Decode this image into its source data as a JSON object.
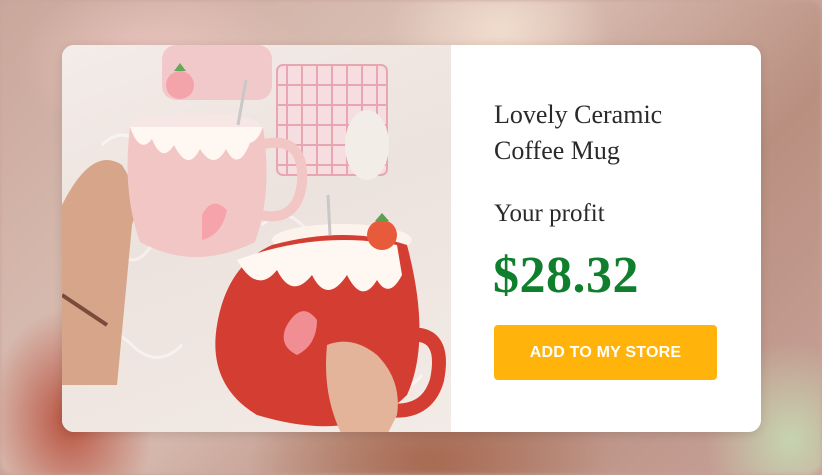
{
  "product": {
    "title": "Lovely Ceramic Coffee Mug",
    "profit_label": "Your profit",
    "price": "$28.32",
    "cta_label": "ADD TO MY STORE"
  },
  "colors": {
    "price": "#0f7f2d",
    "cta_background": "#ffb30b",
    "cta_text": "#ffffff"
  }
}
